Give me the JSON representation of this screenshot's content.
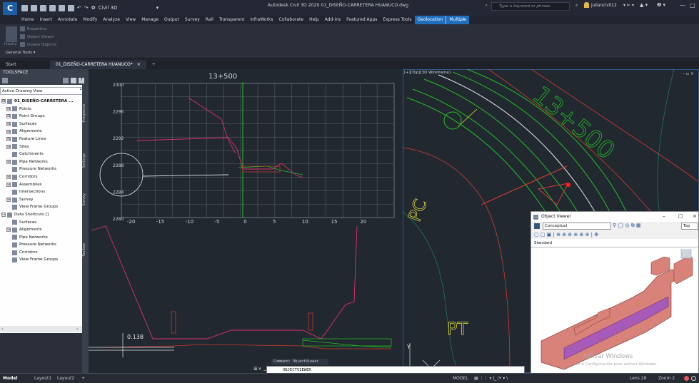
{
  "app": {
    "logo_letter": "C",
    "workspace": "Civil 3D",
    "title": "Autodesk Civil 3D 2020   01_DISEÑO-CARRETERA HUANUCO.dwg",
    "search_placeholder": "Type a keyword or phrase",
    "user": "juliancivil12"
  },
  "menu": {
    "items": [
      "Home",
      "Insert",
      "Annotate",
      "Modify",
      "Analyze",
      "View",
      "Manage",
      "Output",
      "Survey",
      "Rail",
      "Transparent",
      "InfraWorks",
      "Collaborate",
      "Help",
      "Add-ins",
      "Featured Apps",
      "Express Tools"
    ],
    "active_1": "Geolocation",
    "active_2": "Multiple"
  },
  "ribbon": {
    "big_button": "Inquiry",
    "buttons": [
      "Properties",
      "Object Viewer",
      "Isolate Objects"
    ],
    "panel_title": "General Tools ▾"
  },
  "doc_tabs": {
    "start": "Start",
    "active": "01_DISEÑO-CARRETERA HUANUCO*",
    "close": "×",
    "add": "+"
  },
  "toolspace": {
    "title": "TOOLSPACE",
    "view_select": "Active Drawing View",
    "side_labels": [
      "Prospector",
      "Settings",
      "Survey",
      "Toolbox"
    ],
    "tree": [
      {
        "label": "01_DISEÑO-CARRETERA ...",
        "level": 0,
        "exp": "⊟",
        "bold": true
      },
      {
        "label": "Points",
        "level": 1,
        "exp": "⊞"
      },
      {
        "label": "Point Groups",
        "level": 1,
        "exp": "⊞"
      },
      {
        "label": "Surfaces",
        "level": 1,
        "exp": "⊞"
      },
      {
        "label": "Alignments",
        "level": 1,
        "exp": "⊞"
      },
      {
        "label": "Feature Lines",
        "level": 1,
        "exp": "⊞"
      },
      {
        "label": "Sites",
        "level": 1,
        "exp": "⊞"
      },
      {
        "label": "Catchments",
        "level": 1,
        "exp": ""
      },
      {
        "label": "Pipe Networks",
        "level": 1,
        "exp": "⊞"
      },
      {
        "label": "Pressure Networks",
        "level": 1,
        "exp": ""
      },
      {
        "label": "Corridors",
        "level": 1,
        "exp": "⊞"
      },
      {
        "label": "Assemblies",
        "level": 1,
        "exp": "⊞"
      },
      {
        "label": "Intersections",
        "level": 1,
        "exp": ""
      },
      {
        "label": "Survey",
        "level": 1,
        "exp": "⊞"
      },
      {
        "label": "View Frame Groups",
        "level": 1,
        "exp": ""
      },
      {
        "label": "Data Shortcuts []",
        "level": 0,
        "exp": "⊟"
      },
      {
        "label": "Surfaces",
        "level": 1,
        "exp": ""
      },
      {
        "label": "Alignments",
        "level": 1,
        "exp": "⊞"
      },
      {
        "label": "Pipe Networks",
        "level": 1,
        "exp": ""
      },
      {
        "label": "Pressure Networks",
        "level": 1,
        "exp": ""
      },
      {
        "label": "Corridors",
        "level": 1,
        "exp": ""
      },
      {
        "label": "View Frame Groups",
        "level": 1,
        "exp": ""
      }
    ]
  },
  "profile_view": {
    "station": "13+500",
    "y_ticks": [
      "2300",
      "2296",
      "2292",
      "2288",
      "2284",
      "2280"
    ],
    "x_ticks": [
      "-20",
      "-15",
      "-10",
      "-5",
      "0",
      "5",
      "10",
      "15",
      "20"
    ]
  },
  "section_view": {
    "dimension": "0.138",
    "command_tooltip": "Command: ObjectViewer"
  },
  "plan_view": {
    "viewport_label": "[+][Top][3D Wireframe]",
    "station_text": "13+500",
    "label_pc": "PC",
    "label_pt": "PT"
  },
  "object_viewer": {
    "title": "Object Viewer",
    "visual_style": "Conceptual",
    "view": "Top",
    "sub_style": "Standard",
    "watermark_1": "Activar Windows",
    "watermark_2": "Ve a Configuración para activar Windows."
  },
  "command": {
    "input": "OBJECTVIEWER"
  },
  "statusbar": {
    "tabs": [
      "Model",
      "Layout1",
      "Layout2",
      "+"
    ],
    "model_indicator": "MODEL",
    "lens": "Lens 28",
    "zoom": "Zoom 2"
  }
}
